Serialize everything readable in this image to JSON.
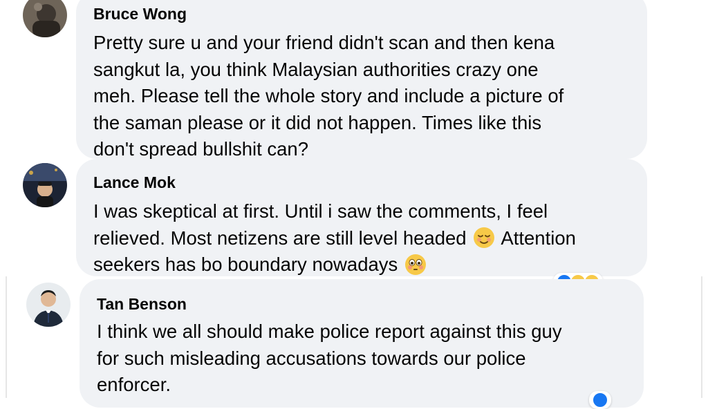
{
  "comments": [
    {
      "author": "Bruce Wong",
      "avatar_icon": "user-avatar-bruce",
      "lines": [
        "Pretty sure u and your friend didn't scan and then kena",
        "sangkut la, you think Malaysian authorities crazy one",
        "meh. Please tell the whole story and include a picture of",
        "the saman please or it did not happen. Times like this",
        "don't spread bullshit can?"
      ]
    },
    {
      "author": "Lance Mok",
      "avatar_icon": "user-avatar-lance",
      "line1": "I was skeptical at first. Until i saw the comments, I feel",
      "line2_before": "relieved. Most netizens are still level headed",
      "line2_after": "Attention",
      "line3_before": "seekers has bo boundary nowadays",
      "emoji_1": "relieved-face-emoji",
      "emoji_2": "flushed-face-emoji",
      "reaction_icons": [
        "like-reaction-icon",
        "haha-reaction-icon",
        "haha-reaction-icon"
      ]
    },
    {
      "author": "Tan Benson",
      "avatar_icon": "user-avatar-tan",
      "lines": [
        "I think we all should make police report against this guy",
        "for such misleading accusations towards our police",
        "enforcer."
      ],
      "reaction_icons": [
        "like-reaction-icon"
      ]
    }
  ],
  "colors": {
    "bubble_bg": "#f0f2f5",
    "text": "#050505",
    "like_blue": "#1877f2",
    "haha_yellow": "#f7c948"
  }
}
